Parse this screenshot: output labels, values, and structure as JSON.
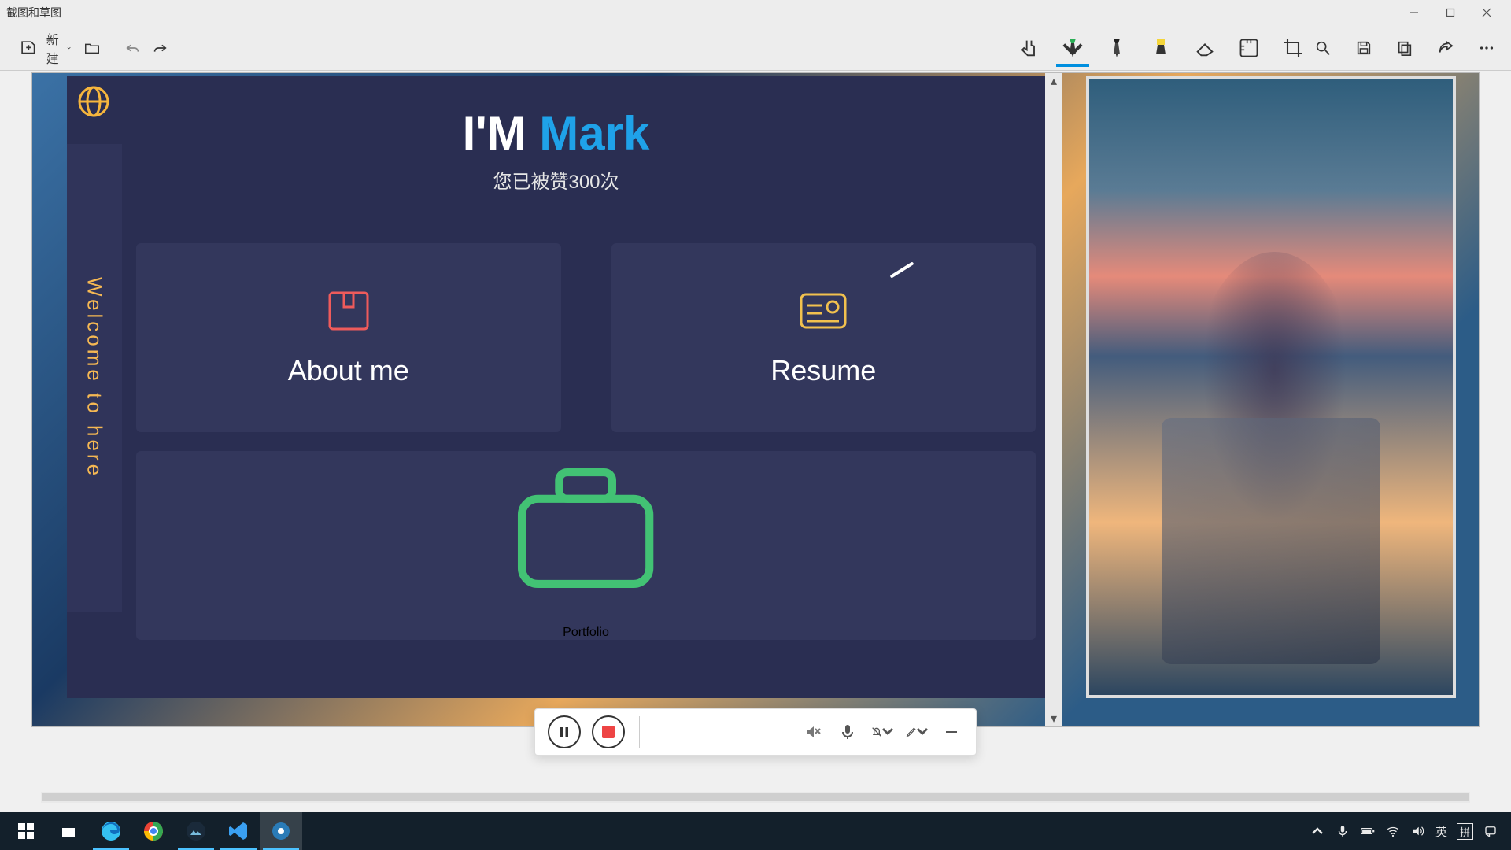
{
  "window": {
    "title": "截图和草图"
  },
  "toolbar": {
    "new_label": "新建",
    "tools": {
      "new": "new",
      "new_chevron": "chevron-down",
      "open": "open-folder",
      "undo": "undo",
      "redo": "redo",
      "touch": "touch-write",
      "pen_green": "felt-pen-green",
      "pen_black": "ball-pen-black",
      "marker_yellow": "highlighter-yellow",
      "eraser": "eraser",
      "ruler": "ruler",
      "crop": "crop",
      "zoom": "zoom",
      "save": "save",
      "copy": "copy",
      "share": "share",
      "more": "more"
    }
  },
  "hero": {
    "prefix": "I'M ",
    "name": "Mark",
    "sub": "您已被赞300次"
  },
  "sidebar_text": "Welcome to here",
  "cards": [
    {
      "id": "about",
      "label": "About me",
      "icon": "book-red"
    },
    {
      "id": "resume",
      "label": "Resume",
      "icon": "id-card-yellow"
    },
    {
      "id": "portfolio",
      "label": "Portfolio",
      "icon": "briefcase-green"
    }
  ],
  "rec_bar": {
    "pause": "pause",
    "stop": "stop",
    "speaker_muted": "speaker-muted",
    "mic": "microphone",
    "bell_off": "notifications-off",
    "pen": "draw-pen",
    "minimize": "minimize"
  },
  "taskbar": {
    "apps": [
      {
        "id": "start",
        "name": "start-menu"
      },
      {
        "id": "store",
        "name": "microsoft-store"
      },
      {
        "id": "edge",
        "name": "edge-browser"
      },
      {
        "id": "chrome",
        "name": "chrome-browser"
      },
      {
        "id": "photos",
        "name": "photos-app"
      },
      {
        "id": "vscode",
        "name": "vscode"
      },
      {
        "id": "recorder",
        "name": "screen-recorder"
      }
    ],
    "tray": {
      "chevron": "chevron-up",
      "mic": "mic",
      "battery": "battery",
      "wifi": "wifi",
      "volume": "volume",
      "ime1": "英",
      "ime2": "拼",
      "notify": "notifications"
    }
  }
}
